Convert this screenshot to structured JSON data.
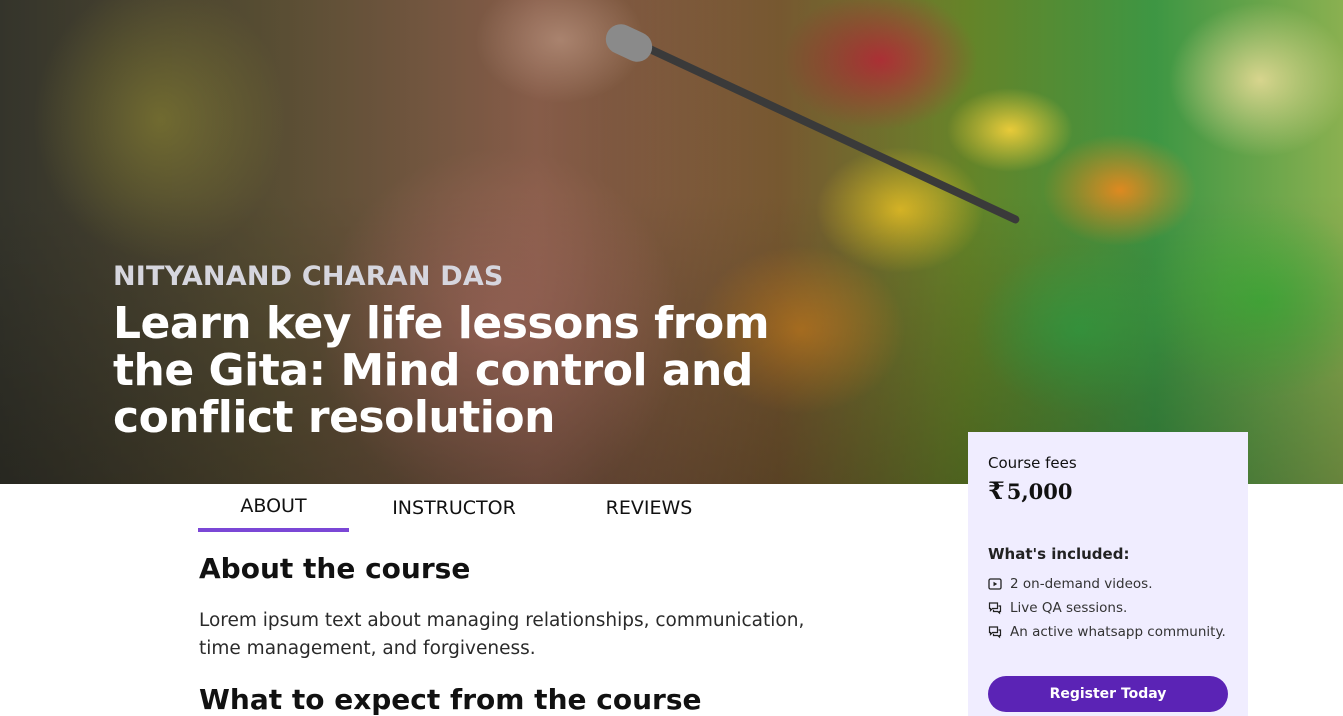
{
  "hero": {
    "author": "NITYANAND CHARAN DAS",
    "title": "Learn key life lessons from the Gita: Mind control and conflict resolution"
  },
  "tabs": [
    {
      "label": "ABOUT",
      "active": true
    },
    {
      "label": "INSTRUCTOR",
      "active": false
    },
    {
      "label": "REVIEWS",
      "active": false
    }
  ],
  "about": {
    "heading": "About the course",
    "text": "Lorem ipsum text about managing relationships, communication, time management, and forgiveness.",
    "expect_heading": "What to expect from the course"
  },
  "fee_card": {
    "label": "Course fees",
    "currency_symbol": "₹",
    "amount": "5,000",
    "included_label": "What's included:",
    "items": [
      {
        "icon": "video-play-icon",
        "text": "2 on-demand videos."
      },
      {
        "icon": "chat-bubbles-icon",
        "text": "Live QA sessions."
      },
      {
        "icon": "chat-bubbles-icon",
        "text": "An active whatsapp community."
      }
    ],
    "register_label": "Register Today"
  },
  "colors": {
    "accent": "#7b47d6",
    "button": "#5b23b5",
    "card_bg": "#f0edff"
  }
}
